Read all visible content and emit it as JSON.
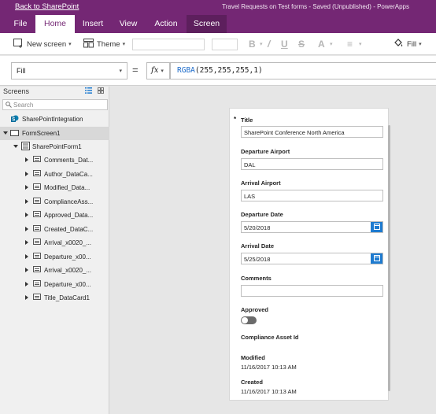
{
  "window": {
    "back_link": "Back to SharePoint",
    "doc_title": "Travel Requests on Test forms - Saved (Unpublished) - PowerApps"
  },
  "tabs": [
    {
      "label": "File"
    },
    {
      "label": "Home",
      "active": true
    },
    {
      "label": "Insert"
    },
    {
      "label": "View"
    },
    {
      "label": "Action"
    },
    {
      "label": "Screen",
      "contextual": true
    }
  ],
  "toolbar": {
    "new_screen": "New screen",
    "theme": "Theme",
    "bold": "B",
    "italic": "/",
    "underline": "U",
    "strike": "S",
    "font_color": "A",
    "align": "≡",
    "fill": "Fill"
  },
  "formula_bar": {
    "property": "Fill",
    "equals": "=",
    "fx": "fx",
    "formula_fn": "RGBA",
    "formula_args": "(255,255,255,1)"
  },
  "screens_panel": {
    "title": "Screens",
    "search_placeholder": "Search",
    "items": [
      {
        "label": "SharePointIntegration",
        "level": 0,
        "kind": "sharepoint"
      },
      {
        "label": "FormScreen1",
        "level": 0,
        "kind": "screen",
        "expanded": true,
        "selected": true
      },
      {
        "label": "SharePointForm1",
        "level": 1,
        "kind": "form",
        "expanded": true
      },
      {
        "label": "Comments_Dat...",
        "level": 2,
        "kind": "card"
      },
      {
        "label": "Author_DataCa...",
        "level": 2,
        "kind": "card"
      },
      {
        "label": "Modified_Data...",
        "level": 2,
        "kind": "card"
      },
      {
        "label": "ComplianceAss...",
        "level": 2,
        "kind": "card"
      },
      {
        "label": "Approved_Data...",
        "level": 2,
        "kind": "card"
      },
      {
        "label": "Created_DataC...",
        "level": 2,
        "kind": "card"
      },
      {
        "label": "Arrival_x0020_...",
        "level": 2,
        "kind": "card"
      },
      {
        "label": "Departure_x00...",
        "level": 2,
        "kind": "card"
      },
      {
        "label": "Arrival_x0020_...",
        "level": 2,
        "kind": "card"
      },
      {
        "label": "Departure_x00...",
        "level": 2,
        "kind": "card"
      },
      {
        "label": "Title_DataCard1",
        "level": 2,
        "kind": "card"
      }
    ]
  },
  "form": {
    "title_label": "Title",
    "required_mark": "*",
    "title_value": "SharePoint Conference North America",
    "departure_airport_label": "Departure Airport",
    "departure_airport_value": "DAL",
    "arrival_airport_label": "Arrival Airport",
    "arrival_airport_value": "LAS",
    "departure_date_label": "Departure Date",
    "departure_date_value": "5/20/2018",
    "arrival_date_label": "Arrival Date",
    "arrival_date_value": "5/25/2018",
    "comments_label": "Comments",
    "comments_value": "",
    "approved_label": "Approved",
    "approved_on": false,
    "compliance_label": "Compliance Asset Id",
    "modified_label": "Modified",
    "modified_value": "11/16/2017 10:13 AM",
    "created_label": "Created",
    "created_value": "11/16/2017 10:13 AM"
  },
  "colors": {
    "brand": "#742774",
    "accent": "#1e7bd0"
  }
}
